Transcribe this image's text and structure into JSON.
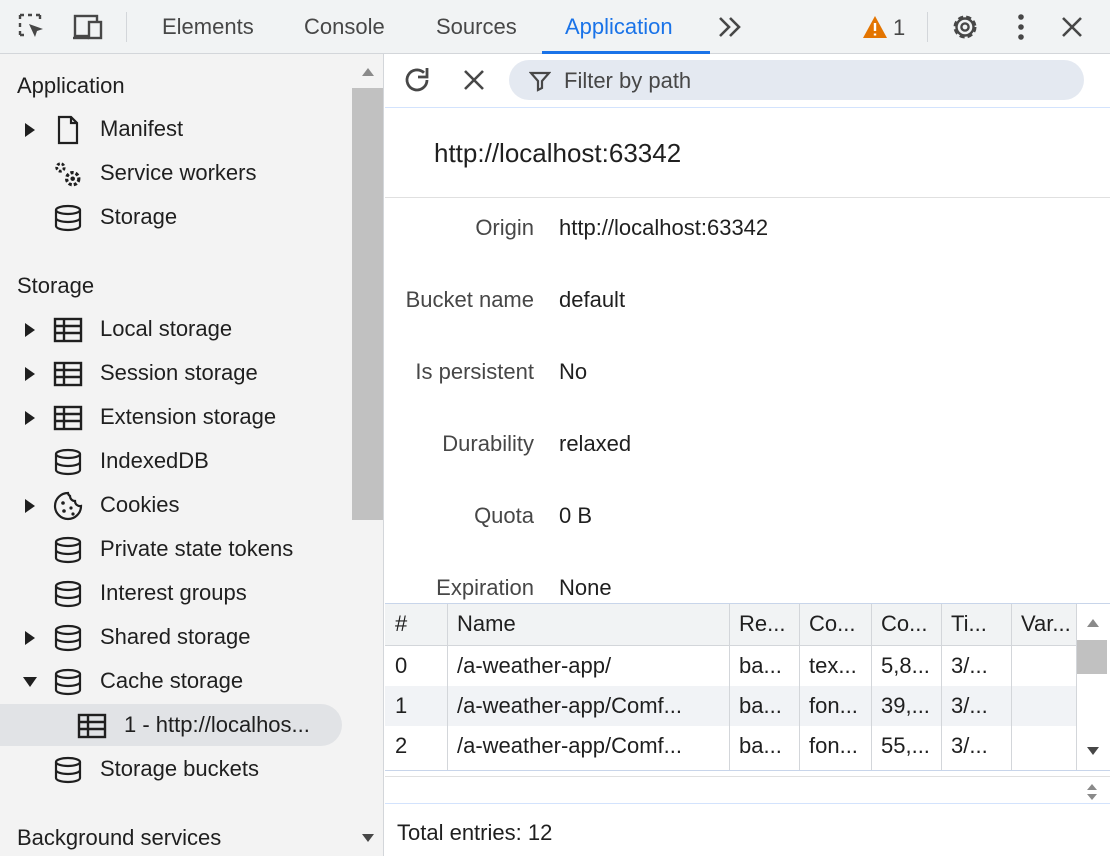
{
  "toolbar": {
    "tabs": [
      "Elements",
      "Console",
      "Sources",
      "Application"
    ],
    "active_tab": "Application",
    "warning_count": "1",
    "accent_color": "#1a73e8",
    "warning_color": "#e37400",
    "icons": [
      "inspect-element-icon",
      "device-toolbar-icon",
      "more-tabs-icon",
      "warning-icon",
      "settings-icon",
      "more-options-icon",
      "close-icon"
    ]
  },
  "sidebar": {
    "application_heading": "Application",
    "application_items": [
      {
        "label": "Manifest",
        "icon": "document-icon",
        "expandable": true
      },
      {
        "label": "Service workers",
        "icon": "gears-icon",
        "expandable": false
      },
      {
        "label": "Storage",
        "icon": "database-icon",
        "expandable": false
      }
    ],
    "storage_heading": "Storage",
    "storage_items": [
      {
        "label": "Local storage",
        "icon": "table-icon",
        "expandable": true
      },
      {
        "label": "Session storage",
        "icon": "table-icon",
        "expandable": true
      },
      {
        "label": "Extension storage",
        "icon": "table-icon",
        "expandable": true
      },
      {
        "label": "IndexedDB",
        "icon": "database-icon",
        "expandable": false
      },
      {
        "label": "Cookies",
        "icon": "cookie-icon",
        "expandable": true
      },
      {
        "label": "Private state tokens",
        "icon": "database-icon",
        "expandable": false
      },
      {
        "label": "Interest groups",
        "icon": "database-icon",
        "expandable": false
      },
      {
        "label": "Shared storage",
        "icon": "database-icon",
        "expandable": true
      },
      {
        "label": "Cache storage",
        "icon": "database-icon",
        "expandable": true,
        "expanded": true
      }
    ],
    "cache_child": "1 - http://localhos...",
    "storage_buckets": "Storage buckets",
    "background_heading": "Background services"
  },
  "main": {
    "filter_placeholder": "Filter by path",
    "heading": "http://localhost:63342",
    "details": [
      {
        "key": "Origin",
        "value": "http://localhost:63342"
      },
      {
        "key": "Bucket name",
        "value": "default"
      },
      {
        "key": "Is persistent",
        "value": "No"
      },
      {
        "key": "Durability",
        "value": "relaxed"
      },
      {
        "key": "Quota",
        "value": "0 B"
      },
      {
        "key": "Expiration",
        "value": "None"
      }
    ],
    "table": {
      "headers": [
        "#",
        "Name",
        "Re...",
        "Co...",
        "Co...",
        "Ti...",
        "Var..."
      ],
      "rows": [
        [
          "0",
          "/a-weather-app/",
          "ba...",
          "tex...",
          "5,8...",
          "3/...",
          ""
        ],
        [
          "1",
          "/a-weather-app/Comf...",
          "ba...",
          "fon...",
          "39,...",
          "3/...",
          ""
        ],
        [
          "2",
          "/a-weather-app/Comf...",
          "ba...",
          "fon...",
          "55,...",
          "3/...",
          ""
        ]
      ]
    },
    "total_entries": "Total entries: 12"
  }
}
